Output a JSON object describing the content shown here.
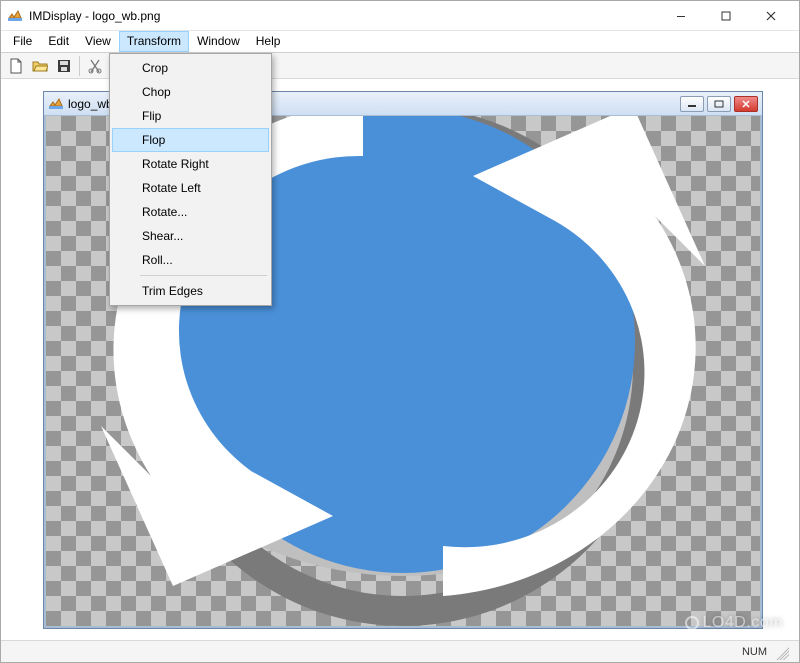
{
  "window": {
    "title": "IMDisplay - logo_wb.png"
  },
  "menubar": {
    "items": [
      {
        "label": "File"
      },
      {
        "label": "Edit"
      },
      {
        "label": "View"
      },
      {
        "label": "Transform",
        "active": true
      },
      {
        "label": "Window"
      },
      {
        "label": "Help"
      }
    ]
  },
  "toolbar": {
    "icons": [
      "new-file-icon",
      "open-file-icon",
      "save-icon",
      "cut-icon"
    ]
  },
  "dropdown": {
    "items": [
      {
        "label": "Crop"
      },
      {
        "label": "Chop"
      },
      {
        "label": "Flip"
      },
      {
        "label": "Flop",
        "highlight": true
      },
      {
        "label": "Rotate Right"
      },
      {
        "label": "Rotate Left"
      },
      {
        "label": "Rotate..."
      },
      {
        "label": "Shear..."
      },
      {
        "label": "Roll..."
      },
      {
        "sep": true
      },
      {
        "label": "Trim Edges"
      }
    ]
  },
  "document": {
    "title": "logo_wb.png"
  },
  "statusbar": {
    "num": "NUM"
  },
  "colors": {
    "disc": "#4a90d9",
    "disc_shadow": "#7a7a7a",
    "arrow": "#ffffff",
    "arrow_shadow": "#bfbfbf"
  },
  "watermark": "LO4D.com"
}
